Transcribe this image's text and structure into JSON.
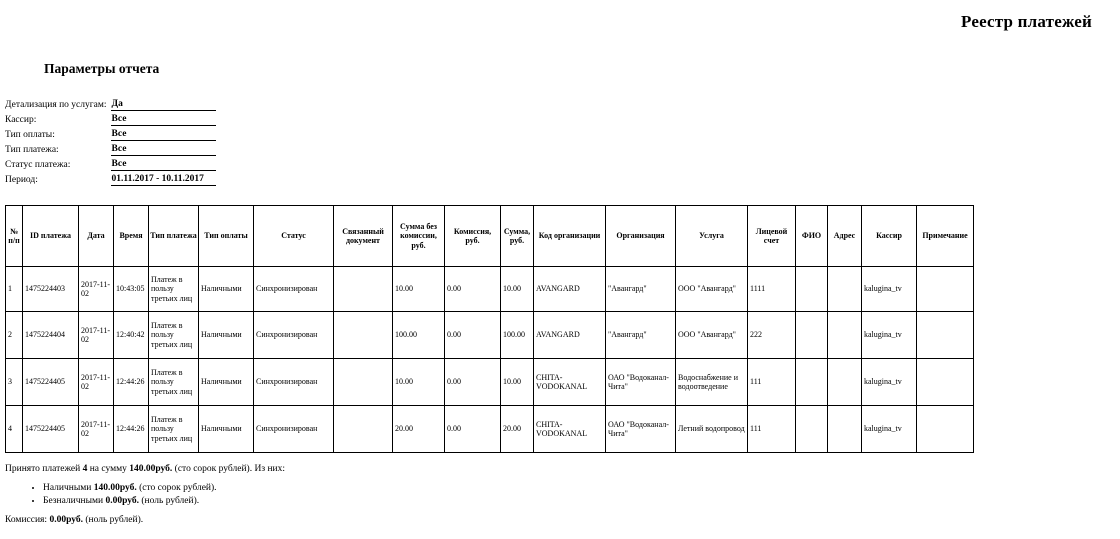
{
  "report": {
    "title": "Реестр платежей",
    "params_heading": "Параметры отчета"
  },
  "params": [
    {
      "label": "Детализация по услугам:",
      "value": "Да"
    },
    {
      "label": "Кассир:",
      "value": "Все"
    },
    {
      "label": "Тип оплаты:",
      "value": "Все"
    },
    {
      "label": "Тип платежа:",
      "value": "Все"
    },
    {
      "label": "Статус платежа:",
      "value": "Все"
    },
    {
      "label": "Период:",
      "value": "01.11.2017 - 10.11.2017"
    }
  ],
  "table": {
    "headers": {
      "no": "№ п/п",
      "payment_id": "ID платежа",
      "date": "Дата",
      "time": "Время",
      "payment_type": "Тип платежа",
      "pay_method": "Тип оплаты",
      "status": "Статус",
      "related_doc": "Связанный документ",
      "sum_no_comm": "Сумма без комиссии, руб.",
      "commission": "Комиссия, руб.",
      "sum": "Сумма, руб.",
      "org_code": "Код организации",
      "organization": "Организация",
      "service": "Услуга",
      "account": "Лицевой счет",
      "fio": "ФИО",
      "address": "Адрес",
      "cashier": "Кассир",
      "note": "Примечание"
    },
    "rows": [
      {
        "no": "1",
        "payment_id": "1475224403",
        "date": "2017-11-02",
        "time": "10:43:05",
        "payment_type": "Платеж в пользу третьих лиц",
        "pay_method": "Наличными",
        "status": "Синхронизирован",
        "related_doc": "",
        "sum_no_comm": "10.00",
        "commission": "0.00",
        "sum": "10.00",
        "org_code": "AVANGARD",
        "organization": "\"Авангард\"",
        "service": "ООО \"Авангард\"",
        "account": "1111",
        "fio": "",
        "address": "",
        "cashier": "kalugina_tv",
        "note": ""
      },
      {
        "no": "2",
        "payment_id": "1475224404",
        "date": "2017-11-02",
        "time": "12:40:42",
        "payment_type": "Платеж в пользу третьих лиц",
        "pay_method": "Наличными",
        "status": "Синхронизирован",
        "related_doc": "",
        "sum_no_comm": "100.00",
        "commission": "0.00",
        "sum": "100.00",
        "org_code": "AVANGARD",
        "organization": "\"Авангард\"",
        "service": "ООО \"Авангард\"",
        "account": "222",
        "fio": "",
        "address": "",
        "cashier": "kalugina_tv",
        "note": ""
      },
      {
        "no": "3",
        "payment_id": "1475224405",
        "date": "2017-11-02",
        "time": "12:44:26",
        "payment_type": "Платеж в пользу третьих лиц",
        "pay_method": "Наличными",
        "status": "Синхронизирован",
        "related_doc": "",
        "sum_no_comm": "10.00",
        "commission": "0.00",
        "sum": "10.00",
        "org_code": "CHITA-VODOKANAL",
        "organization": "ОАО \"Водоканал-Чита\"",
        "service": "Водоснабжение и водоотведение",
        "account": "111",
        "fio": "",
        "address": "",
        "cashier": "kalugina_tv",
        "note": ""
      },
      {
        "no": "4",
        "payment_id": "1475224405",
        "date": "2017-11-02",
        "time": "12:44:26",
        "payment_type": "Платеж в пользу третьих лиц",
        "pay_method": "Наличными",
        "status": "Синхронизирован",
        "related_doc": "",
        "sum_no_comm": "20.00",
        "commission": "0.00",
        "sum": "20.00",
        "org_code": "CHITA-VODOKANAL",
        "organization": "ОАО \"Водоканал-Чита\"",
        "service": "Летний водопровод",
        "account": "111",
        "fio": "",
        "address": "",
        "cashier": "kalugina_tv",
        "note": ""
      }
    ]
  },
  "summary": {
    "total_prefix": "Принято платежей",
    "total_count": "4",
    "total_mid": "на сумму",
    "total_amount": "140.00руб.",
    "total_words": "(сто сорок рублей). Из них:",
    "cash_label": "Наличными",
    "cash_amount": "140.00руб.",
    "cash_words": "(сто сорок рублей).",
    "cashless_label": "Безналичными",
    "cashless_amount": "0.00руб.",
    "cashless_words": "(ноль рублей).",
    "commission_label": "Комиссия:",
    "commission_amount": "0.00руб.",
    "commission_words": "(ноль рублей)."
  }
}
